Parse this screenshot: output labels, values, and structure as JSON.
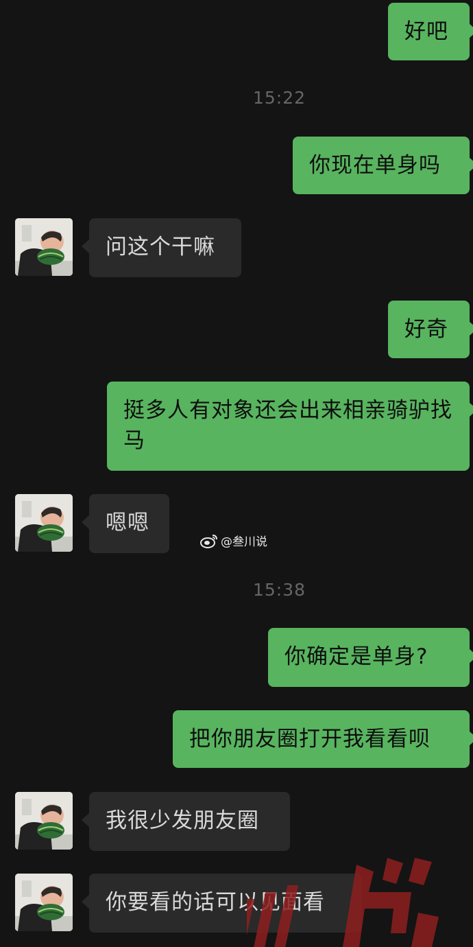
{
  "messages": [
    {
      "side": "me",
      "text": "好吧"
    },
    {
      "side": "time",
      "text": "15:22"
    },
    {
      "side": "me",
      "text": "你现在单身吗"
    },
    {
      "side": "them",
      "text": "问这个干嘛"
    },
    {
      "side": "me",
      "text": "好奇"
    },
    {
      "side": "me",
      "text": "挺多人有对象还会出来相亲骑驴找马"
    },
    {
      "side": "them",
      "text": "嗯嗯"
    },
    {
      "side": "time",
      "text": "15:38"
    },
    {
      "side": "me",
      "text": "你确定是单身?"
    },
    {
      "side": "me",
      "text": "把你朋友圈打开我看看呗"
    },
    {
      "side": "them",
      "text": "我很少发朋友圈"
    },
    {
      "side": "them",
      "text": "你要看的话可以见面看"
    }
  ],
  "watermark": {
    "handle": "@叁川说",
    "icon": "weibo-icon",
    "corner_text": "说"
  },
  "colors": {
    "background": "#141414",
    "my_bubble": "#58b45f",
    "their_bubble": "#2a2a2a",
    "time_text": "#666666"
  }
}
